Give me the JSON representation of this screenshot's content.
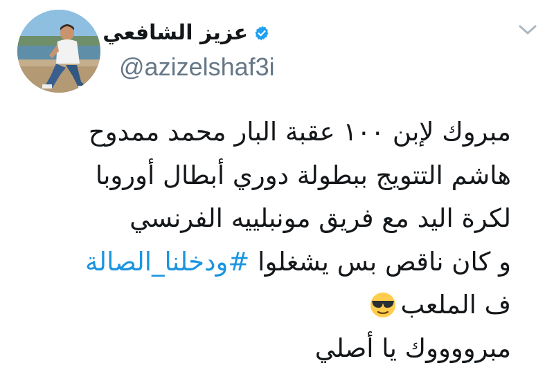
{
  "author": {
    "display_name": "عزيز الشافعي",
    "handle": "@azizelshaf3i",
    "verified_icon": "verified-badge-icon",
    "avatar_icon": "profile-photo"
  },
  "menu": {
    "chevron_icon": "chevron-down-icon"
  },
  "tweet": {
    "line1": "مبروك لإبن ١٠٠ عقبة البار محمد ممدوح",
    "line2": "هاشم التتويج ببطولة دوري أبطال أوروبا",
    "line3": "لكرة اليد مع فريق مونبلييه  الفرنسي",
    "line4_text": "و كان ناقص بس يشغلوا ",
    "line4_hashtag": "#ودخلنا_الصالة",
    "line5": "ف الملعب",
    "line5_emoji": "sunglasses-face-emoji",
    "line6": "مبرووووك يا أصلي"
  },
  "colors": {
    "hashtag": "#1b95e0",
    "handle": "#657786",
    "verified": "#1da1f2",
    "chevron": "#aab8c2"
  }
}
